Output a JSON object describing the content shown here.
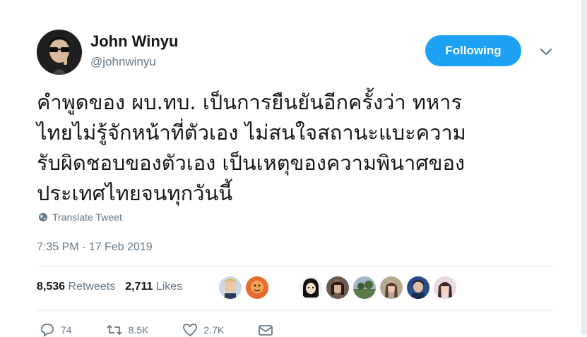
{
  "author": {
    "name": "John Winyu",
    "handle": "@johnwinyu",
    "avatar_icon": "profile-photo-sunglasses"
  },
  "follow_button": {
    "label": "Following",
    "color": "#1da1f2"
  },
  "menu": {
    "icon": "chevron-down-icon"
  },
  "tweet": {
    "lines": [
      "คำพูดของ ผบ.ทบ. เป็นการยืนยันอีกครั้งว่า ทหาร",
      "ไทยไม่รู้จักหน้าที่ตัวเอง ไม่สนใจสถานะแบะความ",
      "รับผิดชอบของตัวเอง เป็นเหตุของความพินาศของ",
      "ประเทศไทยจนทุกวันนี้"
    ]
  },
  "translate": {
    "label": "Translate Tweet",
    "icon": "globe-icon"
  },
  "timestamp": "7:35 PM - 17 Feb 2019",
  "stats": {
    "retweets_count": "8,536",
    "retweets_label": "Retweets",
    "likes_count": "2,711",
    "likes_label": "Likes"
  },
  "likers": [
    {
      "icon": "liker-avatar-1",
      "color": "#c9a27e"
    },
    {
      "icon": "liker-avatar-2",
      "color": "#e86b2e"
    },
    {
      "icon": "liker-avatar-3",
      "color": "#3a3a3a"
    },
    {
      "icon": "liker-avatar-4",
      "color": "#7a6a5e"
    },
    {
      "icon": "liker-avatar-5",
      "color": "#5b7a4a"
    },
    {
      "icon": "liker-avatar-6",
      "color": "#8a7b6a"
    },
    {
      "icon": "liker-avatar-7",
      "color": "#2a4a8a"
    },
    {
      "icon": "liker-avatar-8",
      "color": "#b08a9a"
    }
  ],
  "actions": {
    "reply_count": "74",
    "retweet_count": "8.5K",
    "like_count": "2.7K"
  }
}
